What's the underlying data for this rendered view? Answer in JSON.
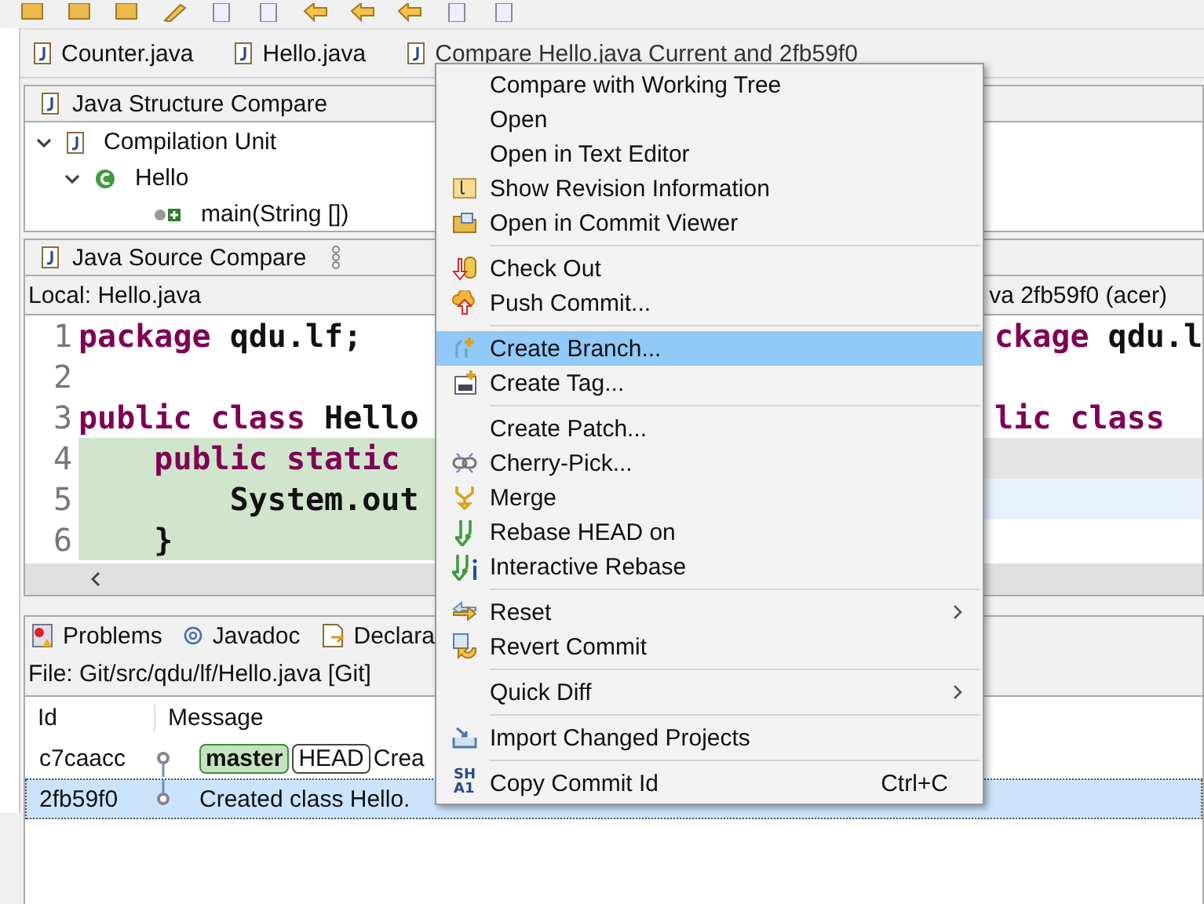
{
  "editor_tabs": [
    {
      "label": "Counter.java",
      "selected": false
    },
    {
      "label": "Hello.java",
      "selected": false
    },
    {
      "label": "Compare Hello.java Current and 2fb59f0",
      "selected": true
    }
  ],
  "structure_compare": {
    "title": "Java Structure Compare",
    "tree": [
      {
        "label": "Compilation Unit",
        "expanded": true,
        "children": [
          {
            "label": "Hello",
            "expanded": true,
            "children": [
              {
                "label": "main(String [])"
              }
            ]
          }
        ]
      }
    ]
  },
  "source_compare": {
    "title": "Java Source Compare",
    "left_label": "Local: Hello.java",
    "right_label": "va 2fb59f0 (acer)",
    "left_lines": [
      {
        "number": "1",
        "changed": false,
        "segments": [
          {
            "text": "package",
            "kind": "keyword"
          },
          {
            "text": " qdu.lf;",
            "kind": "plain"
          }
        ]
      },
      {
        "number": "2",
        "changed": false
      },
      {
        "number": "3",
        "changed": false,
        "segments": [
          {
            "text": "public class",
            "kind": "keyword"
          },
          {
            "text": " Hello",
            "kind": "plain"
          }
        ]
      },
      {
        "number": "4",
        "changed": true,
        "segments": [
          {
            "text": "    public static",
            "kind": "keyword"
          }
        ]
      },
      {
        "number": "5",
        "changed": true,
        "segments": [
          {
            "text": "        System.out",
            "kind": "plain"
          }
        ]
      },
      {
        "number": "6",
        "changed": true,
        "segments": [
          {
            "text": "    }",
            "kind": "plain"
          }
        ]
      }
    ],
    "right_lines": [
      {
        "changed": false,
        "segments": [
          {
            "text": "ckage",
            "kind": "keyword"
          },
          {
            "text": " qdu.l",
            "kind": "plain"
          }
        ]
      },
      {
        "changed": false
      },
      {
        "changed": false,
        "segments": [
          {
            "text": "lic class",
            "kind": "keyword"
          }
        ]
      },
      {
        "changed": true
      },
      {
        "changed": false,
        "selected": true
      },
      {
        "changed": false
      }
    ]
  },
  "bottom_tabs": [
    {
      "label": "Problems",
      "selected": false
    },
    {
      "label": "Javadoc",
      "selected": false
    },
    {
      "label": "Declara",
      "selected": false
    }
  ],
  "history": {
    "file": "File: Git/src/qdu/lf/Hello.java [Git]",
    "columns": [
      "Id",
      "Message"
    ],
    "rows": [
      {
        "id": "c7caacc",
        "refs": [
          {
            "label": "master",
            "kind": "branch"
          },
          {
            "label": "HEAD",
            "kind": "head"
          }
        ],
        "message": "Crea",
        "selected": false
      },
      {
        "id": "2fb59f0",
        "message": "Created class Hello.",
        "selected": true
      }
    ]
  },
  "context_menu": [
    {
      "kind": "item",
      "label": "Compare with Working Tree",
      "selected": false
    },
    {
      "kind": "item",
      "label": "Open",
      "selected": false
    },
    {
      "kind": "item",
      "label": "Open in Text Editor",
      "selected": false
    },
    {
      "kind": "item",
      "label": "Show Revision Information",
      "selected": false
    },
    {
      "kind": "item",
      "label": "Open in Commit Viewer",
      "selected": false
    },
    {
      "kind": "separator"
    },
    {
      "kind": "item",
      "label": "Check Out",
      "selected": false
    },
    {
      "kind": "item",
      "label": "Push Commit...",
      "selected": false
    },
    {
      "kind": "separator"
    },
    {
      "kind": "item",
      "label": "Create Branch...",
      "selected": true
    },
    {
      "kind": "item",
      "label": "Create Tag...",
      "selected": false
    },
    {
      "kind": "separator"
    },
    {
      "kind": "item",
      "label": "Create Patch...",
      "selected": false
    },
    {
      "kind": "item",
      "label": "Cherry-Pick...",
      "selected": false
    },
    {
      "kind": "item",
      "label": "Merge",
      "selected": false
    },
    {
      "kind": "item",
      "label": "Rebase HEAD on",
      "selected": false
    },
    {
      "kind": "item",
      "label": "Interactive Rebase",
      "selected": false
    },
    {
      "kind": "separator"
    },
    {
      "kind": "item",
      "label": "Reset",
      "selected": false,
      "submenu": true
    },
    {
      "kind": "item",
      "label": "Revert Commit",
      "selected": false
    },
    {
      "kind": "separator"
    },
    {
      "kind": "item",
      "label": "Quick Diff",
      "selected": false,
      "submenu": true
    },
    {
      "kind": "separator"
    },
    {
      "kind": "item",
      "label": "Import Changed Projects",
      "selected": false
    },
    {
      "kind": "separator"
    },
    {
      "kind": "item",
      "label": "Copy Commit Id",
      "selected": false,
      "shortcut": "Ctrl+C",
      "icon_text": [
        "SH",
        "A1"
      ]
    }
  ]
}
